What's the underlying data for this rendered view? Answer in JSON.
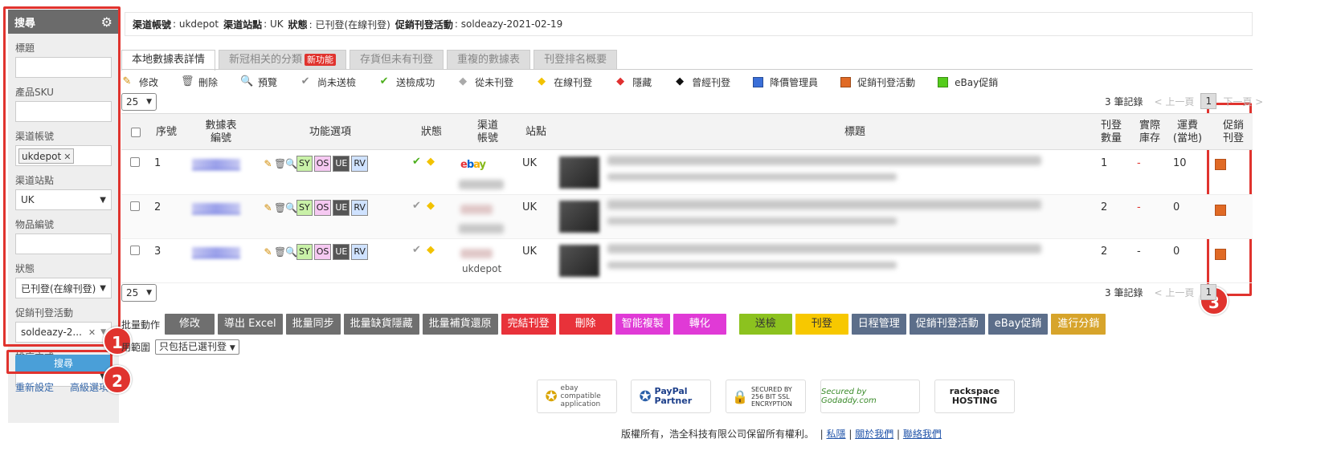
{
  "sidebar": {
    "title": "搜尋",
    "fields": {
      "title_label": "標題",
      "sku_label": "產品SKU",
      "account_label": "渠道帳號",
      "account_tag": "ukdepot",
      "site_label": "渠道站點",
      "site_value": "UK",
      "item_label": "物品編號",
      "status_label": "狀態",
      "status_value": "已刊登(在線刊登)",
      "promo_label": "促銷刊登活動",
      "promo_value": "soldeazy-2...",
      "sort_label": "排序方式"
    },
    "search_button": "搜尋",
    "reset_link": "重新設定",
    "advanced_link": "高級選項"
  },
  "info": {
    "account_label": "渠道帳號",
    "account_value": ": ukdepot",
    "site_label": "渠道站點",
    "site_value": ": UK",
    "status_label": "狀態",
    "status_value": ": 已刊登(在線刊登)",
    "promo_label": "促銷刊登活動",
    "promo_value": ": soldeazy-2021-02-19"
  },
  "tabs": [
    {
      "label": "本地數據表詳情"
    },
    {
      "label": "新冠相关的分類",
      "badge": "新功能"
    },
    {
      "label": "存貨但未有刊登"
    },
    {
      "label": "重複的數據表"
    },
    {
      "label": "刊登排名概要"
    }
  ],
  "legend": [
    "修改",
    "刪除",
    "預覽",
    "尚未送檢",
    "送檢成功",
    "從未刊登",
    "在線刊登",
    "隱藏",
    "曾經刊登",
    "降價管理員",
    "促銷刊登活動",
    "eBay促銷"
  ],
  "colors": {
    "blue_sq": "#3a6fd8",
    "orange_sq": "#e06a25",
    "green_sq": "#55cc1c",
    "highlight": "#e0332e"
  },
  "pager": {
    "per_page": "25",
    "records": "3 筆記錄",
    "prev": "< 上一頁",
    "page": "1",
    "next": "下一頁 >"
  },
  "table": {
    "headers": {
      "seq": "序號",
      "sheet": "數據表\n編號",
      "func": "功能選項",
      "status": "狀態",
      "channel": "渠道\n帳號",
      "site": "站點",
      "title": "標題",
      "qty": "刊登\n數量",
      "stock": "實際\n庫存",
      "ship": "運費\n(當地)",
      "promo": "促銷\n刊登"
    },
    "func_buttons": [
      "SY",
      "OS",
      "UE",
      "RV"
    ],
    "rows": [
      {
        "seq": "1",
        "site": "UK",
        "qty": "1",
        "stock": "-",
        "ship": "10",
        "channel": "ebay"
      },
      {
        "seq": "2",
        "site": "UK",
        "qty": "2",
        "stock": "-",
        "ship": "0",
        "channel": ""
      },
      {
        "seq": "3",
        "site": "UK",
        "qty": "2",
        "stock": "-",
        "ship": "0",
        "channel": "ukdepot"
      }
    ]
  },
  "bulk": {
    "label": "批量動作",
    "buttons": [
      "修改",
      "導出 Excel",
      "批量同步",
      "批量缺貨隱藏",
      "批量補貨還原",
      "完結刊登",
      "刪除",
      "智能複製",
      "轉化",
      "送檢",
      "刊登",
      "日程管理",
      "促銷刊登活動",
      "eBay促銷",
      "進行分銷"
    ],
    "scope_label": "用範圍",
    "scope_value": "只包括已選刊登"
  },
  "footer": {
    "badges": [
      "ebay compatible application",
      "PayPal Partner",
      "SECURED BY 256 BIT SSL ENCRYPTION",
      "Secured by Godaddy.com",
      "rackspace HOSTING"
    ],
    "copyright": "版權所有，浩全科技有限公司保留所有權利。",
    "links": [
      "私隱",
      "關於我們",
      "聯絡我們"
    ]
  },
  "annotations": [
    "1",
    "2",
    "3"
  ]
}
